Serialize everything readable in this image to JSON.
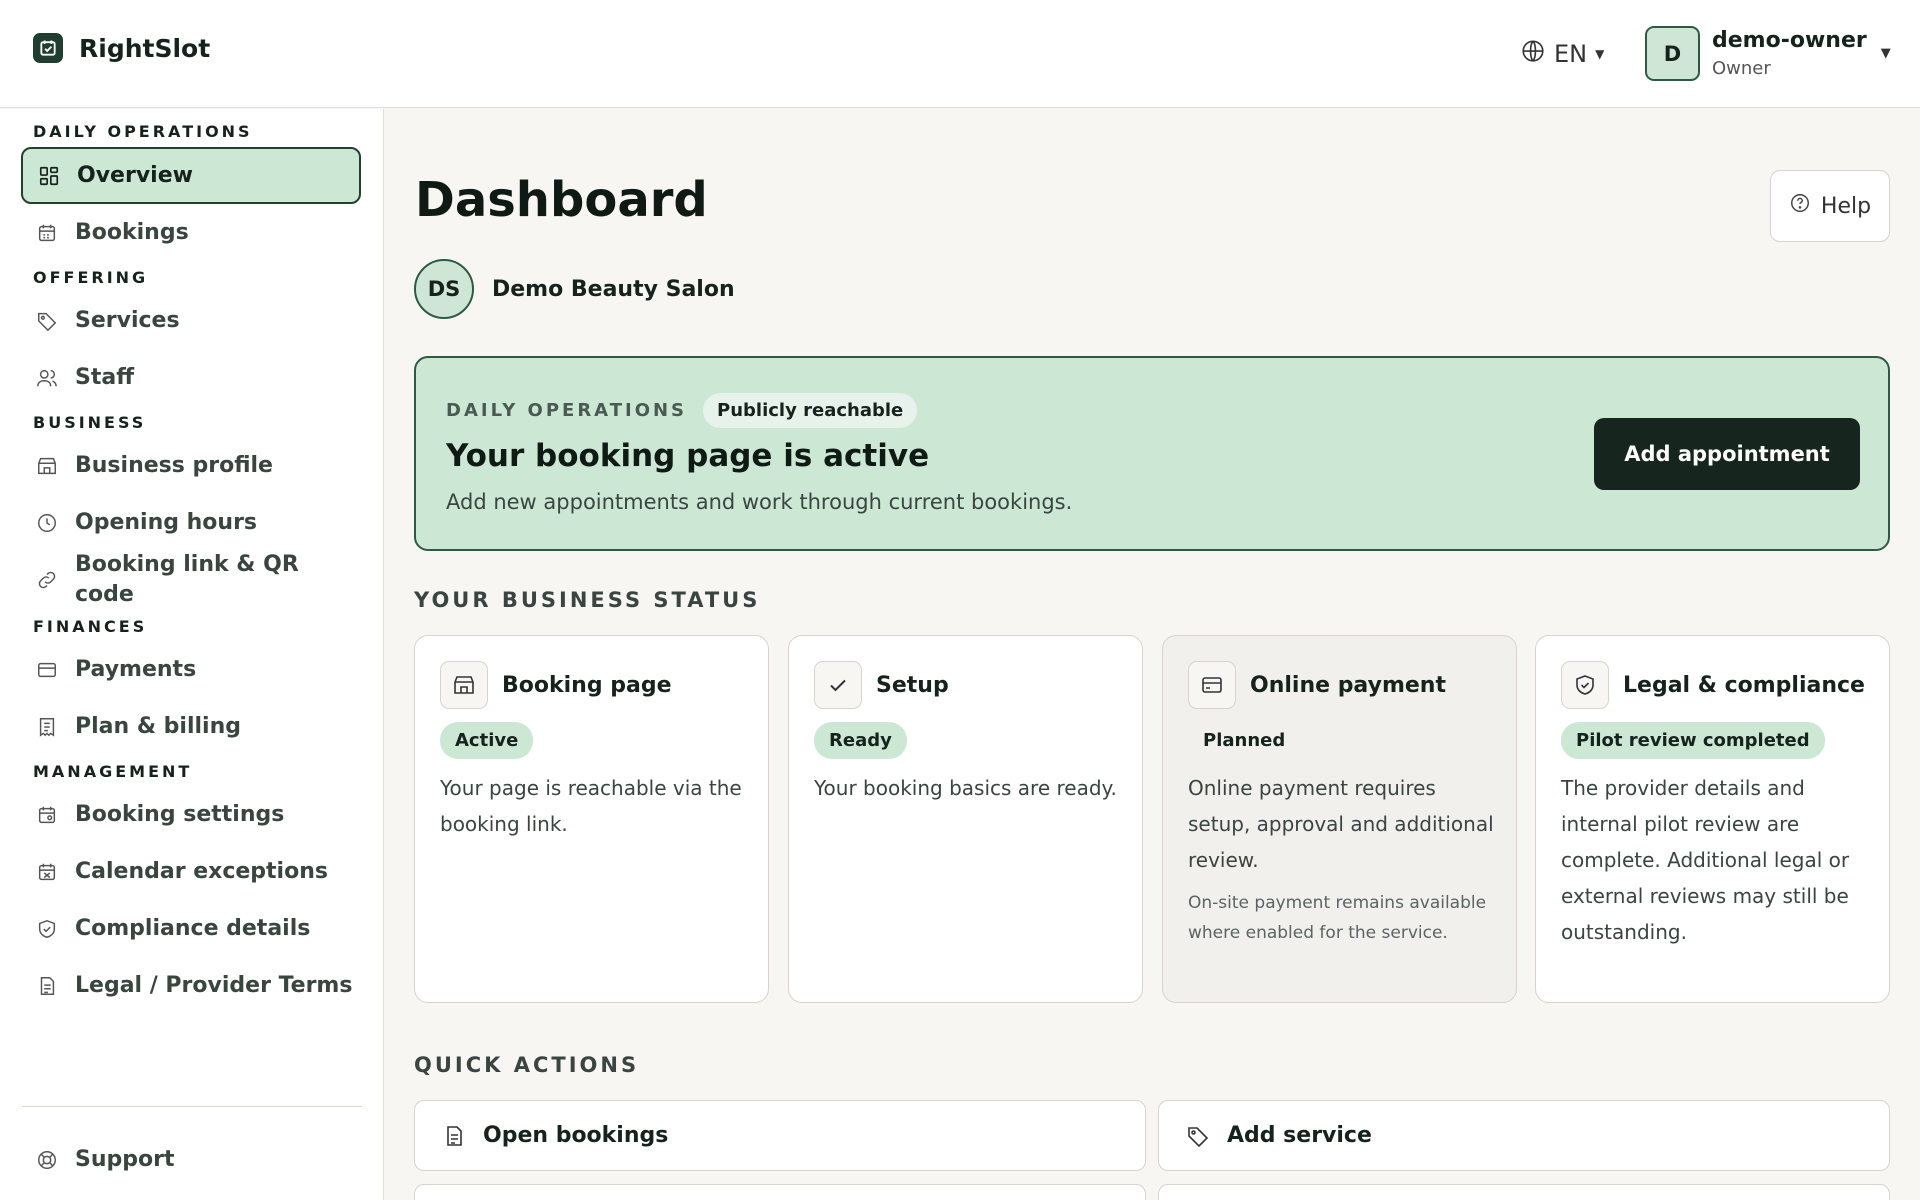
{
  "app": {
    "name": "RightSlot"
  },
  "header": {
    "language": "EN",
    "user": {
      "initial": "D",
      "name": "demo-owner",
      "role": "Owner"
    }
  },
  "sidebar": {
    "sections": {
      "daily": "DAILY OPERATIONS",
      "offering": "OFFERING",
      "business": "BUSINESS",
      "finances": "FINANCES",
      "management": "MANAGEMENT"
    },
    "items": {
      "overview": "Overview",
      "bookings": "Bookings",
      "services": "Services",
      "staff": "Staff",
      "business_profile": "Business profile",
      "opening_hours": "Opening hours",
      "booking_link": "Booking link & QR code",
      "payments": "Payments",
      "plan_billing": "Plan & billing",
      "booking_settings": "Booking settings",
      "calendar_exceptions": "Calendar exceptions",
      "compliance_details": "Compliance details",
      "legal_terms": "Legal / Provider Terms",
      "support": "Support"
    },
    "active": "overview"
  },
  "main": {
    "title": "Dashboard",
    "help_label": "Help",
    "business": {
      "initials": "DS",
      "name": "Demo Beauty Salon"
    },
    "hero": {
      "eyebrow": "DAILY OPERATIONS",
      "badge": "Publicly reachable",
      "title": "Your booking page is active",
      "subtitle": "Add new appointments and work through current bookings.",
      "button": "Add appointment"
    },
    "status_heading": "YOUR BUSINESS STATUS",
    "cards": [
      {
        "title": "Booking page",
        "badge": "Active",
        "text": "Your page is reachable via the booking link.",
        "icon": "storefront-icon"
      },
      {
        "title": "Setup",
        "badge": "Ready",
        "text": "Your booking basics are ready.",
        "icon": "check-icon"
      },
      {
        "title": "Online payment",
        "badge": "Planned",
        "text": "Online payment requires setup, approval and additional review.",
        "note": "On-site payment remains available where enabled for the service.",
        "icon": "credit-card-icon"
      },
      {
        "title": "Legal & compliance",
        "badge": "Pilot review completed",
        "text": "The provider details and internal pilot review are complete. Additional legal or external reviews may still be outstanding.",
        "icon": "shield-check-icon"
      }
    ],
    "quick_heading": "QUICK ACTIONS",
    "quick_actions": [
      {
        "label": "Open bookings",
        "icon": "document-icon"
      },
      {
        "label": "Add service",
        "icon": "tag-icon"
      }
    ]
  },
  "colors": {
    "accent_green": "#cce8d5",
    "dark_green": "#16261e",
    "border_green": "#2e5a44"
  }
}
